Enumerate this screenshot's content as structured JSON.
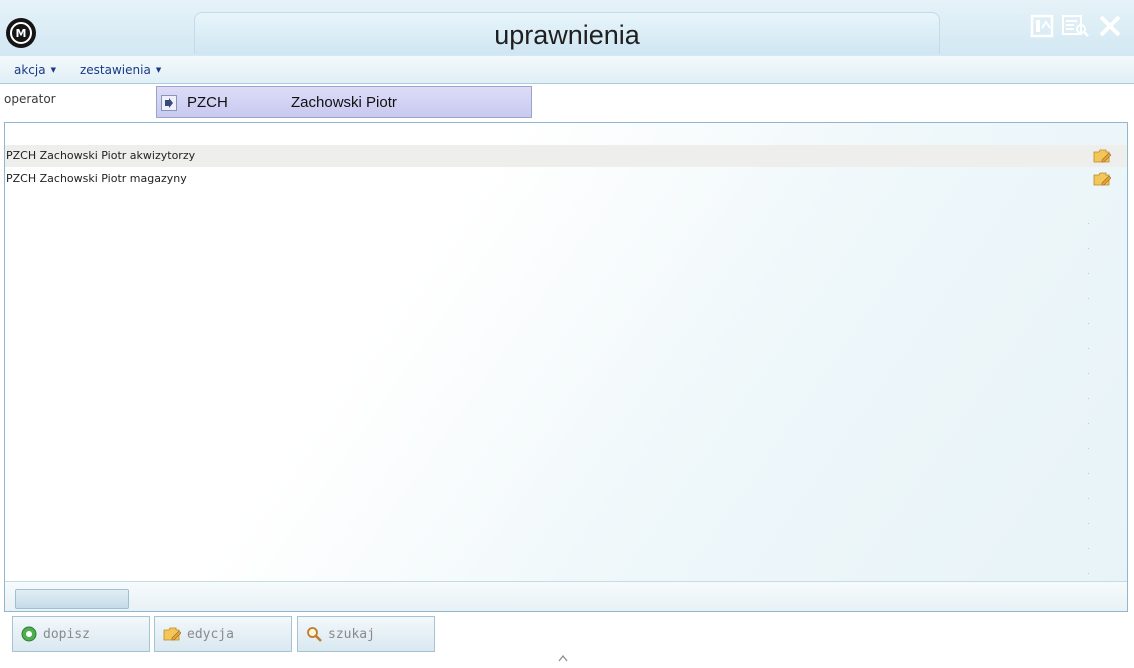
{
  "window": {
    "title": "uprawnienia",
    "logo_letter": "M",
    "icons": [
      "export-icon",
      "preview-icon",
      "close-icon"
    ]
  },
  "menu": {
    "items": [
      {
        "label": "akcja"
      },
      {
        "label": "zestawienia"
      }
    ]
  },
  "operator": {
    "label": "operator",
    "code": "PZCH",
    "name": "Zachowski Piotr"
  },
  "list": {
    "rows": [
      {
        "text": "PZCH Zachowski Piotr akwizytorzy",
        "icon": "folder-edit-icon"
      },
      {
        "text": "PZCH Zachowski Piotr magazyny",
        "icon": "folder-edit-icon"
      }
    ]
  },
  "buttons": [
    {
      "label": "dopisz",
      "icon": "add-icon"
    },
    {
      "label": "edycja",
      "icon": "folder-edit-icon"
    },
    {
      "label": "szukaj",
      "icon": "search-icon"
    }
  ],
  "colors": {
    "accent": "#1a3a88",
    "titlebar": "#d2e8f3",
    "operator_box": "#c9c9f0",
    "row_alt": "#eeeeec"
  }
}
